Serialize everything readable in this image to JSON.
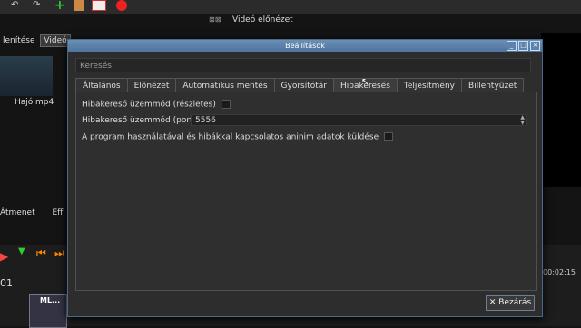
{
  "app": {
    "preview_title": "Videó előnézet",
    "left_tabs": [
      "lenítése",
      "Videó"
    ],
    "file_thumb_label": "Hajó.mp4",
    "bottom_tabs": [
      "Átmenet",
      "Eff"
    ],
    "timeline_left_number": "01",
    "timeline_right_time": "00:02:15",
    "clip_label": "ML..."
  },
  "dialog": {
    "title": "Beállítások",
    "search_placeholder": "Keresés",
    "tabs": [
      "Általános",
      "Előnézet",
      "Automatikus mentés",
      "Gyorsítótár",
      "Hibakeresés",
      "Teljesítmény",
      "Billentyűzet"
    ],
    "active_tab": "Hibakeresés",
    "fields": {
      "debug_verbose_label": "Hibakereső üzemmód (részletes)",
      "debug_port_label": "Hibakereső üzemmód (port)",
      "debug_port_value": "5556",
      "anon_data_label": "A program használatával és hibákkal kapcsolatos aninim adatok küldése"
    },
    "close_label": "Bezárás"
  },
  "colors": {
    "titlebar": "#5a7faa",
    "accent": "#4a6a8a"
  }
}
